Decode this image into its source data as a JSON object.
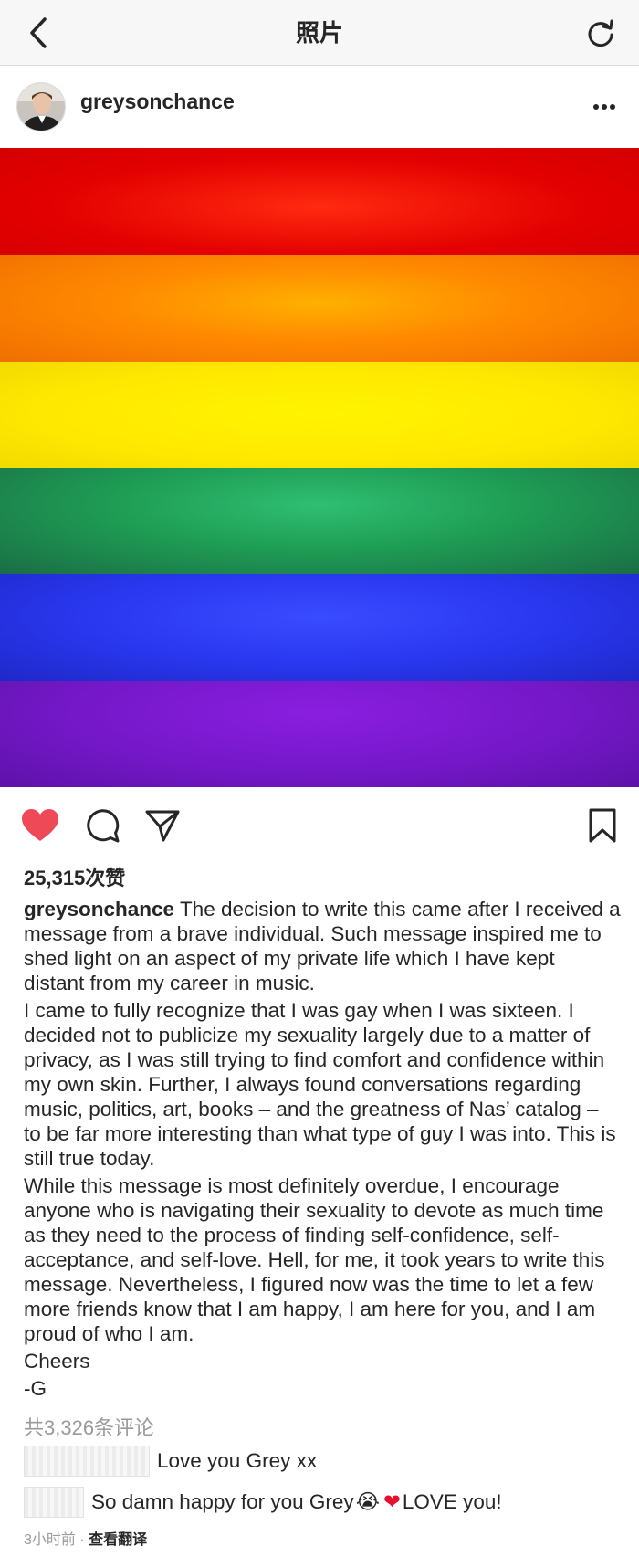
{
  "navbar": {
    "title": "照片",
    "back_icon": "chevron-left-icon",
    "refresh_icon": "refresh-icon"
  },
  "post": {
    "username": "greysonchance",
    "more_icon": "ellipsis-icon",
    "photo": {
      "description": "rainbow-pride-flag",
      "stripe_colors": [
        "#e40000",
        "#ff8400",
        "#ffee00",
        "#1f9d55",
        "#2838f2",
        "#7a18c9"
      ]
    },
    "actions": {
      "like_icon": "heart-filled-icon",
      "comment_icon": "comment-icon",
      "share_icon": "send-icon",
      "save_icon": "bookmark-icon",
      "like_color": "#ed4956"
    },
    "likes": "25,315次赞",
    "caption": {
      "username": "greysonchance",
      "paragraphs": [
        "The decision to write this came after I received a message from a brave individual. Such message inspired me to shed light on an aspect of my private life which I have kept distant from my career in music.",
        "I came to fully recognize that I was gay when I was sixteen. I decided not to publicize my sexuality largely due to a matter of privacy, as I was still trying to find comfort and confidence within my own skin. Further, I always found conversations regarding music, politics, art, books – and the greatness of Nas’ catalog – to be far more interesting than what type of guy I was into. This is still true today.",
        "While this message is most definitely overdue, I encourage anyone who is navigating their sexuality to devote as much time as they need to the process of finding self-confidence, self-acceptance, and self-love. Hell, for me, it took years to write this message. Nevertheless, I figured now was the time to let a few more friends know that I am happy, I am here for you, and I am proud of who I am.",
        "Cheers",
        "-G"
      ]
    },
    "view_comments": "共3,326条评论",
    "comments": [
      {
        "text": "Love you Grey xx"
      },
      {
        "text_before": "So damn happy for you Grey",
        "emoji_1": "😭",
        "emoji_2": "❤",
        "text_after": " LOVE you!",
        "heart_color": "#e8112d"
      }
    ],
    "timestamp": "3小时前",
    "separator": "·",
    "translate": "查看翻译"
  }
}
